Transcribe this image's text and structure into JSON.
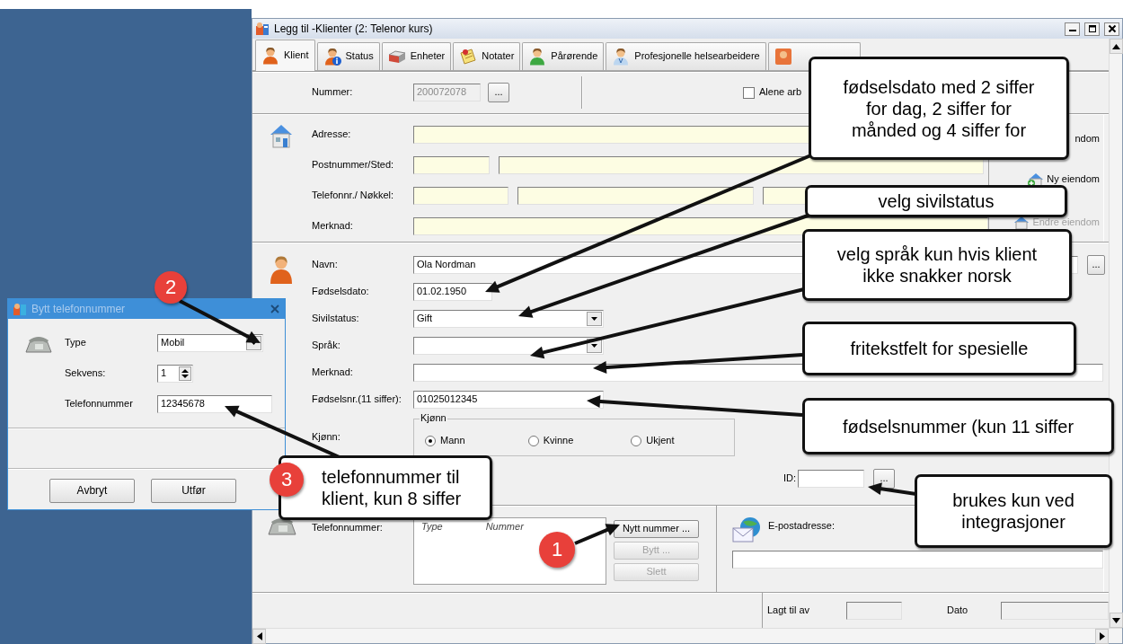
{
  "window": {
    "title": "Legg til -Klienter (2: Telenor kurs)"
  },
  "tabs": [
    {
      "label": "Klient",
      "selected": true
    },
    {
      "label": "Status",
      "selected": false
    },
    {
      "label": "Enheter",
      "selected": false
    },
    {
      "label": "Notater",
      "selected": false
    },
    {
      "label": "Pårørende",
      "selected": false
    },
    {
      "label": "Profesjonelle helsearbeidere",
      "selected": false
    }
  ],
  "number_row": {
    "label": "Nummer:",
    "value": "200072078",
    "disabled": true,
    "browse": "...",
    "checkbox": {
      "label": "Alene arb",
      "checked": false
    }
  },
  "address": {
    "fields": [
      {
        "label": "Adresse:"
      },
      {
        "label": "Postnummer/Sted:"
      },
      {
        "label": "Telefonnr./ Nøkkel:"
      },
      {
        "label": "Merknad:"
      }
    ],
    "buttons": [
      {
        "label": "ndom",
        "disabled": false
      },
      {
        "label": "Ny eiendom",
        "disabled": false
      },
      {
        "label": "Endre eiendom",
        "disabled": true
      }
    ]
  },
  "person": {
    "fields": [
      {
        "kind": "text",
        "label": "Navn:",
        "value": "Ola Nordman",
        "browse": "..."
      },
      {
        "kind": "text",
        "label": "Fødselsdato:",
        "value": "01.02.1950"
      },
      {
        "kind": "select",
        "label": "Sivilstatus:",
        "value": "Gift"
      },
      {
        "kind": "select",
        "label": "Språk:"
      },
      {
        "kind": "text",
        "label": "Merknad:"
      },
      {
        "kind": "text",
        "label": "Fødselsnr.(11 siffer):",
        "value": "01025012345"
      }
    ],
    "gender": {
      "label": "Kjønn:",
      "legend": "Kjønn",
      "options": [
        {
          "label": "Mann",
          "selected": true
        },
        {
          "label": "Kvinne",
          "selected": false
        },
        {
          "label": "Ukjent",
          "selected": false
        }
      ]
    },
    "id": {
      "label": "ID:",
      "browse": "..."
    }
  },
  "phone": {
    "label": "Telefonnummer:",
    "columns": [
      "Type",
      "Nummer"
    ],
    "buttons": [
      {
        "label": "Nytt nummer ...",
        "disabled": false
      },
      {
        "label": "Bytt ...",
        "disabled": true
      },
      {
        "label": "Slett",
        "disabled": true
      }
    ]
  },
  "email": {
    "label": "E-postadresse:"
  },
  "footer": {
    "fields": [
      {
        "label": "Lagt til av"
      },
      {
        "label": "Dato"
      }
    ]
  },
  "dialog": {
    "title": "Bytt telefonnummer",
    "active": false,
    "fields": [
      {
        "kind": "select",
        "label": "Type",
        "value": "Mobil"
      },
      {
        "kind": "spinner",
        "label": "Sekvens:",
        "value": "1"
      },
      {
        "kind": "text",
        "label": "Telefonnummer",
        "value": "12345678"
      }
    ],
    "buttons": [
      "Avbryt",
      "Utfør"
    ]
  },
  "callouts": [
    {
      "text": "fødselsdato med 2 siffer for dag, 2 siffer for månded og 4 siffer for"
    },
    {
      "text": "velg sivilstatus"
    },
    {
      "text": "velg språk kun hvis klient ikke snakker norsk"
    },
    {
      "text": "fritekstfelt for spesielle"
    },
    {
      "text": "fødselsnummer (kun 11 siffer"
    },
    {
      "text": "brukes kun ved integrasjoner"
    },
    {
      "text": "telefonnummer til klient, kun 8 siffer",
      "badge": "3"
    }
  ],
  "badges": [
    {
      "text": "2"
    },
    {
      "text": "1"
    }
  ]
}
